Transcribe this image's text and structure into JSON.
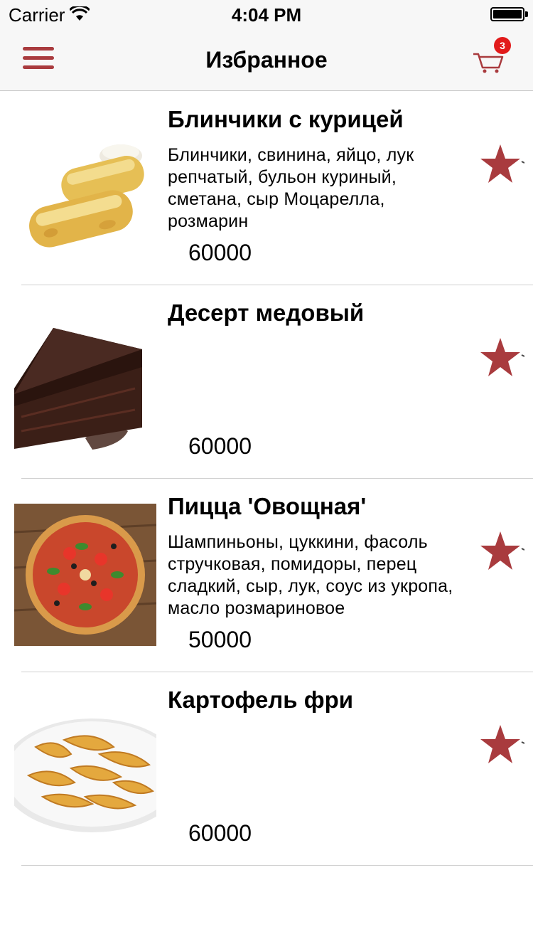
{
  "status_bar": {
    "carrier": "Carrier",
    "time": "4:04 PM"
  },
  "nav": {
    "title": "Избранное",
    "cart_count": "3",
    "accent_color": "#a93b3e"
  },
  "items": [
    {
      "title": "Блинчики с курицей",
      "description": "Блинчики, свинина, яйцо, лук репчатый, бульон куриный, сметана, сыр Моцарелла, розмарин",
      "price": "60000",
      "image": "crepes-image"
    },
    {
      "title": "Десерт медовый",
      "description": "",
      "price": "60000",
      "image": "chocolate-cake-image"
    },
    {
      "title": "Пицца 'Овощная'",
      "description": "Шампиньоны, цуккини, фасоль стручковая, помидоры,   перец сладкий, сыр, лук, соус из укропа, масло розмариновое",
      "price": "50000",
      "image": "pizza-image"
    },
    {
      "title": "Картофель фри",
      "description": "",
      "price": "60000",
      "image": "potato-wedges-image"
    }
  ]
}
